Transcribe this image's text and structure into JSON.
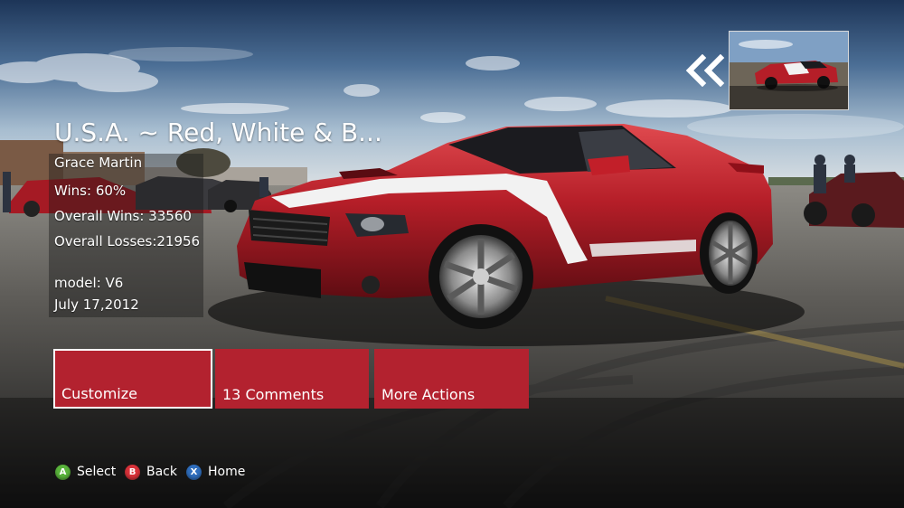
{
  "detail": {
    "title": "U.S.A. ~ Red, White & B...",
    "author": "Grace Martin",
    "wins": "Wins: 60%",
    "overall_wins": "Overall Wins: 33560",
    "overall_losses": "Overall Losses:21956",
    "model": "model: V6",
    "date": "July 17,2012"
  },
  "actions": [
    {
      "label": "Customize",
      "focused": true
    },
    {
      "label": "13 Comments",
      "focused": false
    },
    {
      "label": "More Actions",
      "focused": false
    }
  ],
  "controller_legend": [
    {
      "glyph": "A",
      "label": "Select",
      "color": "#5ab43c"
    },
    {
      "glyph": "B",
      "label": "Back",
      "color": "#d9323a"
    },
    {
      "glyph": "X",
      "label": "Home",
      "color": "#2f6ebd"
    }
  ],
  "colors": {
    "tile": "#b3222f",
    "car_body": "#b51e28",
    "stripe": "#f2f2f2"
  },
  "icons": {
    "previous": "double-chevron-left-icon"
  }
}
